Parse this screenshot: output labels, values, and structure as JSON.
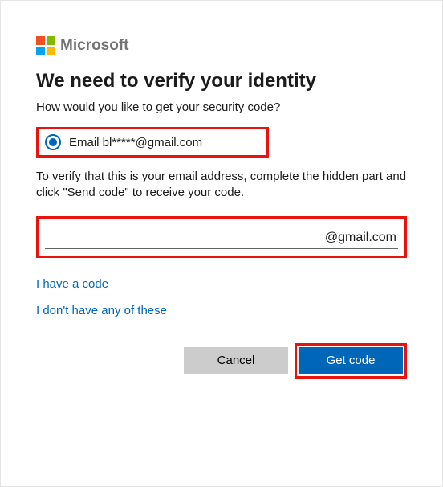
{
  "brand": {
    "name": "Microsoft"
  },
  "title": "We need to verify your identity",
  "subtitle": "How would you like to get your security code?",
  "verify_option": {
    "label": "Email bl*****@gmail.com"
  },
  "instructions": "To verify that this is your email address, complete the hidden part and click \"Send code\" to receive your code.",
  "email_input": {
    "value": "",
    "domain_suffix": "@gmail.com"
  },
  "links": {
    "have_code": "I have a code",
    "none_of_these": "I don't have any of these"
  },
  "buttons": {
    "cancel": "Cancel",
    "get_code": "Get code"
  }
}
